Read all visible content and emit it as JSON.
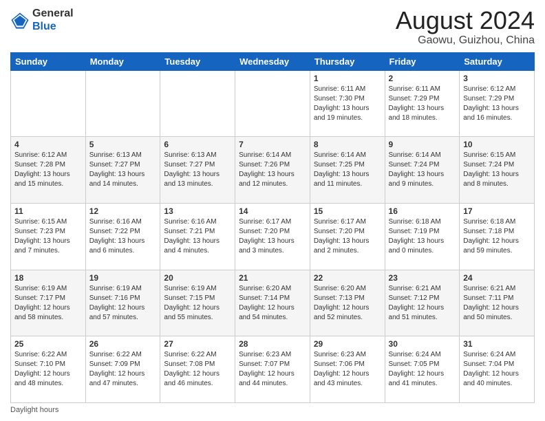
{
  "header": {
    "logo_general": "General",
    "logo_blue": "Blue",
    "main_title": "August 2024",
    "subtitle": "Gaowu, Guizhou, China"
  },
  "days_of_week": [
    "Sunday",
    "Monday",
    "Tuesday",
    "Wednesday",
    "Thursday",
    "Friday",
    "Saturday"
  ],
  "weeks": [
    [
      {
        "day": "",
        "info": ""
      },
      {
        "day": "",
        "info": ""
      },
      {
        "day": "",
        "info": ""
      },
      {
        "day": "",
        "info": ""
      },
      {
        "day": "1",
        "info": "Sunrise: 6:11 AM\nSunset: 7:30 PM\nDaylight: 13 hours\nand 19 minutes."
      },
      {
        "day": "2",
        "info": "Sunrise: 6:11 AM\nSunset: 7:29 PM\nDaylight: 13 hours\nand 18 minutes."
      },
      {
        "day": "3",
        "info": "Sunrise: 6:12 AM\nSunset: 7:29 PM\nDaylight: 13 hours\nand 16 minutes."
      }
    ],
    [
      {
        "day": "4",
        "info": "Sunrise: 6:12 AM\nSunset: 7:28 PM\nDaylight: 13 hours\nand 15 minutes."
      },
      {
        "day": "5",
        "info": "Sunrise: 6:13 AM\nSunset: 7:27 PM\nDaylight: 13 hours\nand 14 minutes."
      },
      {
        "day": "6",
        "info": "Sunrise: 6:13 AM\nSunset: 7:27 PM\nDaylight: 13 hours\nand 13 minutes."
      },
      {
        "day": "7",
        "info": "Sunrise: 6:14 AM\nSunset: 7:26 PM\nDaylight: 13 hours\nand 12 minutes."
      },
      {
        "day": "8",
        "info": "Sunrise: 6:14 AM\nSunset: 7:25 PM\nDaylight: 13 hours\nand 11 minutes."
      },
      {
        "day": "9",
        "info": "Sunrise: 6:14 AM\nSunset: 7:24 PM\nDaylight: 13 hours\nand 9 minutes."
      },
      {
        "day": "10",
        "info": "Sunrise: 6:15 AM\nSunset: 7:24 PM\nDaylight: 13 hours\nand 8 minutes."
      }
    ],
    [
      {
        "day": "11",
        "info": "Sunrise: 6:15 AM\nSunset: 7:23 PM\nDaylight: 13 hours\nand 7 minutes."
      },
      {
        "day": "12",
        "info": "Sunrise: 6:16 AM\nSunset: 7:22 PM\nDaylight: 13 hours\nand 6 minutes."
      },
      {
        "day": "13",
        "info": "Sunrise: 6:16 AM\nSunset: 7:21 PM\nDaylight: 13 hours\nand 4 minutes."
      },
      {
        "day": "14",
        "info": "Sunrise: 6:17 AM\nSunset: 7:20 PM\nDaylight: 13 hours\nand 3 minutes."
      },
      {
        "day": "15",
        "info": "Sunrise: 6:17 AM\nSunset: 7:20 PM\nDaylight: 13 hours\nand 2 minutes."
      },
      {
        "day": "16",
        "info": "Sunrise: 6:18 AM\nSunset: 7:19 PM\nDaylight: 13 hours\nand 0 minutes."
      },
      {
        "day": "17",
        "info": "Sunrise: 6:18 AM\nSunset: 7:18 PM\nDaylight: 12 hours\nand 59 minutes."
      }
    ],
    [
      {
        "day": "18",
        "info": "Sunrise: 6:19 AM\nSunset: 7:17 PM\nDaylight: 12 hours\nand 58 minutes."
      },
      {
        "day": "19",
        "info": "Sunrise: 6:19 AM\nSunset: 7:16 PM\nDaylight: 12 hours\nand 57 minutes."
      },
      {
        "day": "20",
        "info": "Sunrise: 6:19 AM\nSunset: 7:15 PM\nDaylight: 12 hours\nand 55 minutes."
      },
      {
        "day": "21",
        "info": "Sunrise: 6:20 AM\nSunset: 7:14 PM\nDaylight: 12 hours\nand 54 minutes."
      },
      {
        "day": "22",
        "info": "Sunrise: 6:20 AM\nSunset: 7:13 PM\nDaylight: 12 hours\nand 52 minutes."
      },
      {
        "day": "23",
        "info": "Sunrise: 6:21 AM\nSunset: 7:12 PM\nDaylight: 12 hours\nand 51 minutes."
      },
      {
        "day": "24",
        "info": "Sunrise: 6:21 AM\nSunset: 7:11 PM\nDaylight: 12 hours\nand 50 minutes."
      }
    ],
    [
      {
        "day": "25",
        "info": "Sunrise: 6:22 AM\nSunset: 7:10 PM\nDaylight: 12 hours\nand 48 minutes."
      },
      {
        "day": "26",
        "info": "Sunrise: 6:22 AM\nSunset: 7:09 PM\nDaylight: 12 hours\nand 47 minutes."
      },
      {
        "day": "27",
        "info": "Sunrise: 6:22 AM\nSunset: 7:08 PM\nDaylight: 12 hours\nand 46 minutes."
      },
      {
        "day": "28",
        "info": "Sunrise: 6:23 AM\nSunset: 7:07 PM\nDaylight: 12 hours\nand 44 minutes."
      },
      {
        "day": "29",
        "info": "Sunrise: 6:23 AM\nSunset: 7:06 PM\nDaylight: 12 hours\nand 43 minutes."
      },
      {
        "day": "30",
        "info": "Sunrise: 6:24 AM\nSunset: 7:05 PM\nDaylight: 12 hours\nand 41 minutes."
      },
      {
        "day": "31",
        "info": "Sunrise: 6:24 AM\nSunset: 7:04 PM\nDaylight: 12 hours\nand 40 minutes."
      }
    ]
  ],
  "footer": {
    "note": "Daylight hours"
  }
}
